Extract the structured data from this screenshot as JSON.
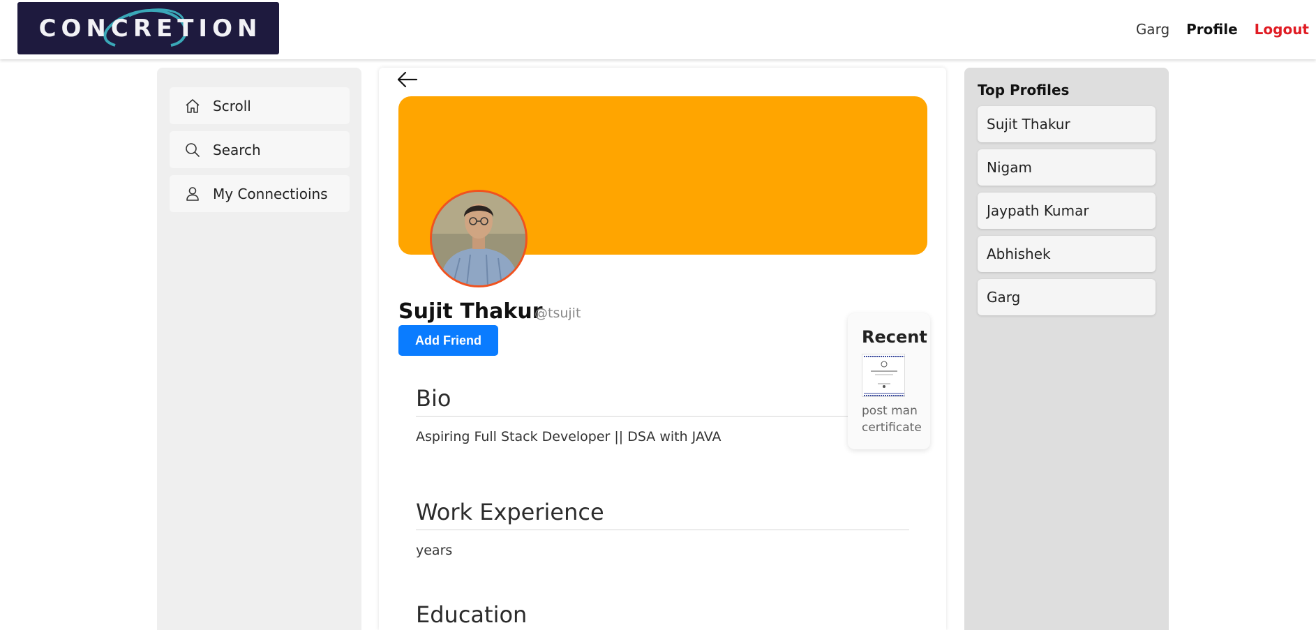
{
  "header": {
    "logo_text": "CONCRETION",
    "nav": {
      "user": "Garg",
      "profile": "Profile",
      "logout": "Logout"
    }
  },
  "sidebar": {
    "items": [
      {
        "label": "Scroll",
        "icon": "home-icon"
      },
      {
        "label": "Search",
        "icon": "search-icon"
      },
      {
        "label": "My Connectioins",
        "icon": "user-icon"
      }
    ]
  },
  "profile": {
    "cover_color": "#ffa500",
    "name": "Sujit Thakur",
    "handle": "@tsujit",
    "add_friend_label": "Add Friend",
    "sections": [
      {
        "title": "Bio",
        "content": "Aspiring Full Stack Developer || DSA with JAVA"
      },
      {
        "title": "Work Experience",
        "content": "years"
      },
      {
        "title": "Education",
        "content": ""
      }
    ]
  },
  "recent": {
    "title": "Recent",
    "item_caption": "post man certificate"
  },
  "top_profiles": {
    "title": "Top Profiles",
    "items": [
      "Sujit Thakur",
      "Nigam",
      "Jaypath Kumar",
      "Abhishek",
      "Garg"
    ]
  },
  "colors": {
    "accent": "#0a7cff",
    "logout": "#e01c24",
    "avatar_border": "#f0521f",
    "logo_bg": "#1e1a3e"
  }
}
